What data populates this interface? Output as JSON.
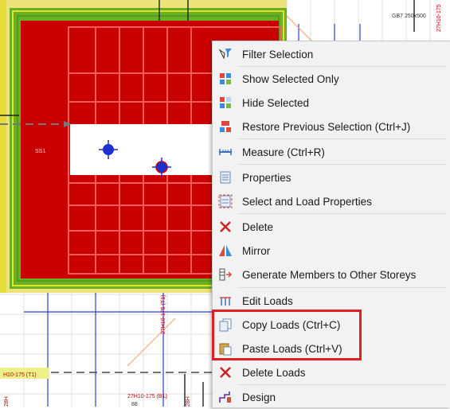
{
  "canvas": {
    "labels": {
      "top_right": "GB7 250x500",
      "left_small": "SS1",
      "rebar1": "27H10-175 (T1)",
      "rebar2": "27H10-175 (B1)",
      "rebar_left": "H10-175 (T1)",
      "vert_a": "28H",
      "vert_b": "28H",
      "vert_c": "27H10-175",
      "mark": "88"
    },
    "colors": {
      "slab": "#c80000",
      "green_band": "#6ab023",
      "yellow_band": "#e4dc3a",
      "grid": "#d9d9d9",
      "blue": "#1f2fd0"
    }
  },
  "menu": {
    "items": [
      {
        "label": "Filter Selection",
        "icon": "filter-icon"
      },
      {
        "label": "Show Selected Only",
        "icon": "show-selected-icon"
      },
      {
        "label": "Hide Selected",
        "icon": "hide-selected-icon"
      },
      {
        "label": "Restore Previous Selection (Ctrl+J)",
        "icon": "restore-selection-icon"
      },
      {
        "label": "Measure (Ctrl+R)",
        "icon": "measure-icon"
      },
      {
        "label": "Properties",
        "icon": "properties-icon"
      },
      {
        "label": "Select and Load Properties",
        "icon": "select-load-properties-icon"
      },
      {
        "label": "Delete",
        "icon": "delete-icon"
      },
      {
        "label": "Mirror",
        "icon": "mirror-icon"
      },
      {
        "label": "Generate Members to Other Storeys",
        "icon": "generate-members-icon"
      },
      {
        "label": "Edit Loads",
        "icon": "edit-loads-icon"
      },
      {
        "label": "Copy Loads (Ctrl+C)",
        "icon": "copy-loads-icon"
      },
      {
        "label": "Paste Loads (Ctrl+V)",
        "icon": "paste-loads-icon"
      },
      {
        "label": "Delete Loads",
        "icon": "delete-loads-icon"
      },
      {
        "label": "Design",
        "icon": "design-icon"
      }
    ],
    "highlight_color": "#e02020"
  }
}
